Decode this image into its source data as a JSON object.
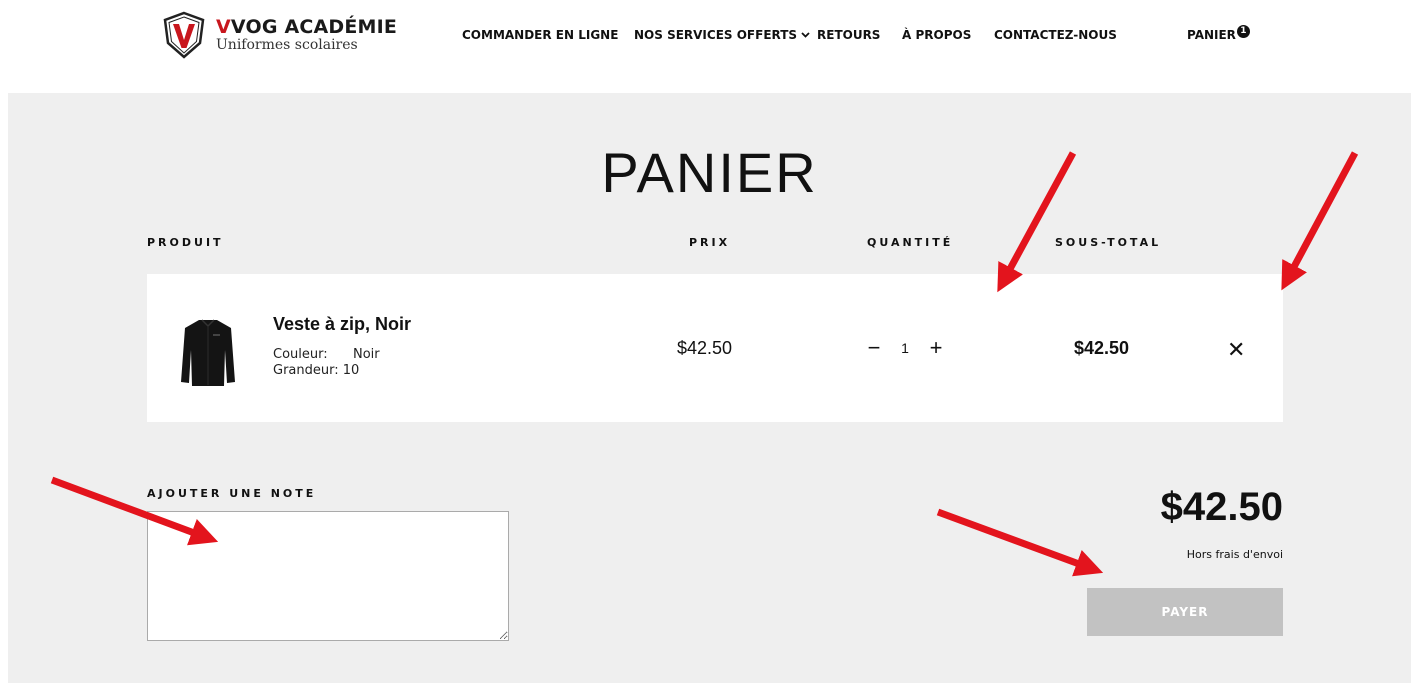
{
  "brand": {
    "name_prefix": "V",
    "name_rest": "VOG ACADÉMIE",
    "subtitle": "Uniformes scolaires"
  },
  "nav": {
    "items": [
      {
        "label": "COMMANDER EN LIGNE"
      },
      {
        "label": "NOS SERVICES OFFERTS",
        "has_dropdown": true
      },
      {
        "label": "RETOURS"
      },
      {
        "label": "À PROPOS"
      },
      {
        "label": "CONTACTEZ-NOUS"
      }
    ],
    "cart": {
      "label": "PANIER",
      "count": "1"
    }
  },
  "page": {
    "title": "PANIER"
  },
  "table": {
    "headers": {
      "product": "PRODUIT",
      "price": "PRIX",
      "quantity": "QUANTITÉ",
      "subtotal": "SOUS-TOTAL"
    },
    "rows": [
      {
        "name": "Veste à zip, Noir",
        "color_label": "Couleur:",
        "color_value": "Noir",
        "size_label": "Grandeur:",
        "size_value": "10",
        "price": "$42.50",
        "quantity": "1",
        "subtotal": "$42.50",
        "remove_symbol": "✕"
      }
    ]
  },
  "note": {
    "label": "AJOUTER UNE NOTE",
    "value": ""
  },
  "summary": {
    "total": "$42.50",
    "shipping_note": "Hors frais d'envoi",
    "pay_label": "PAYER"
  },
  "controls": {
    "minus": "−",
    "plus": "+",
    "chevron": "⌄"
  },
  "colors": {
    "brand_red": "#c8161d",
    "annotation_arrow": "#e3141d",
    "panel_bg": "#efefef",
    "pay_button": "#c2c2c2"
  }
}
